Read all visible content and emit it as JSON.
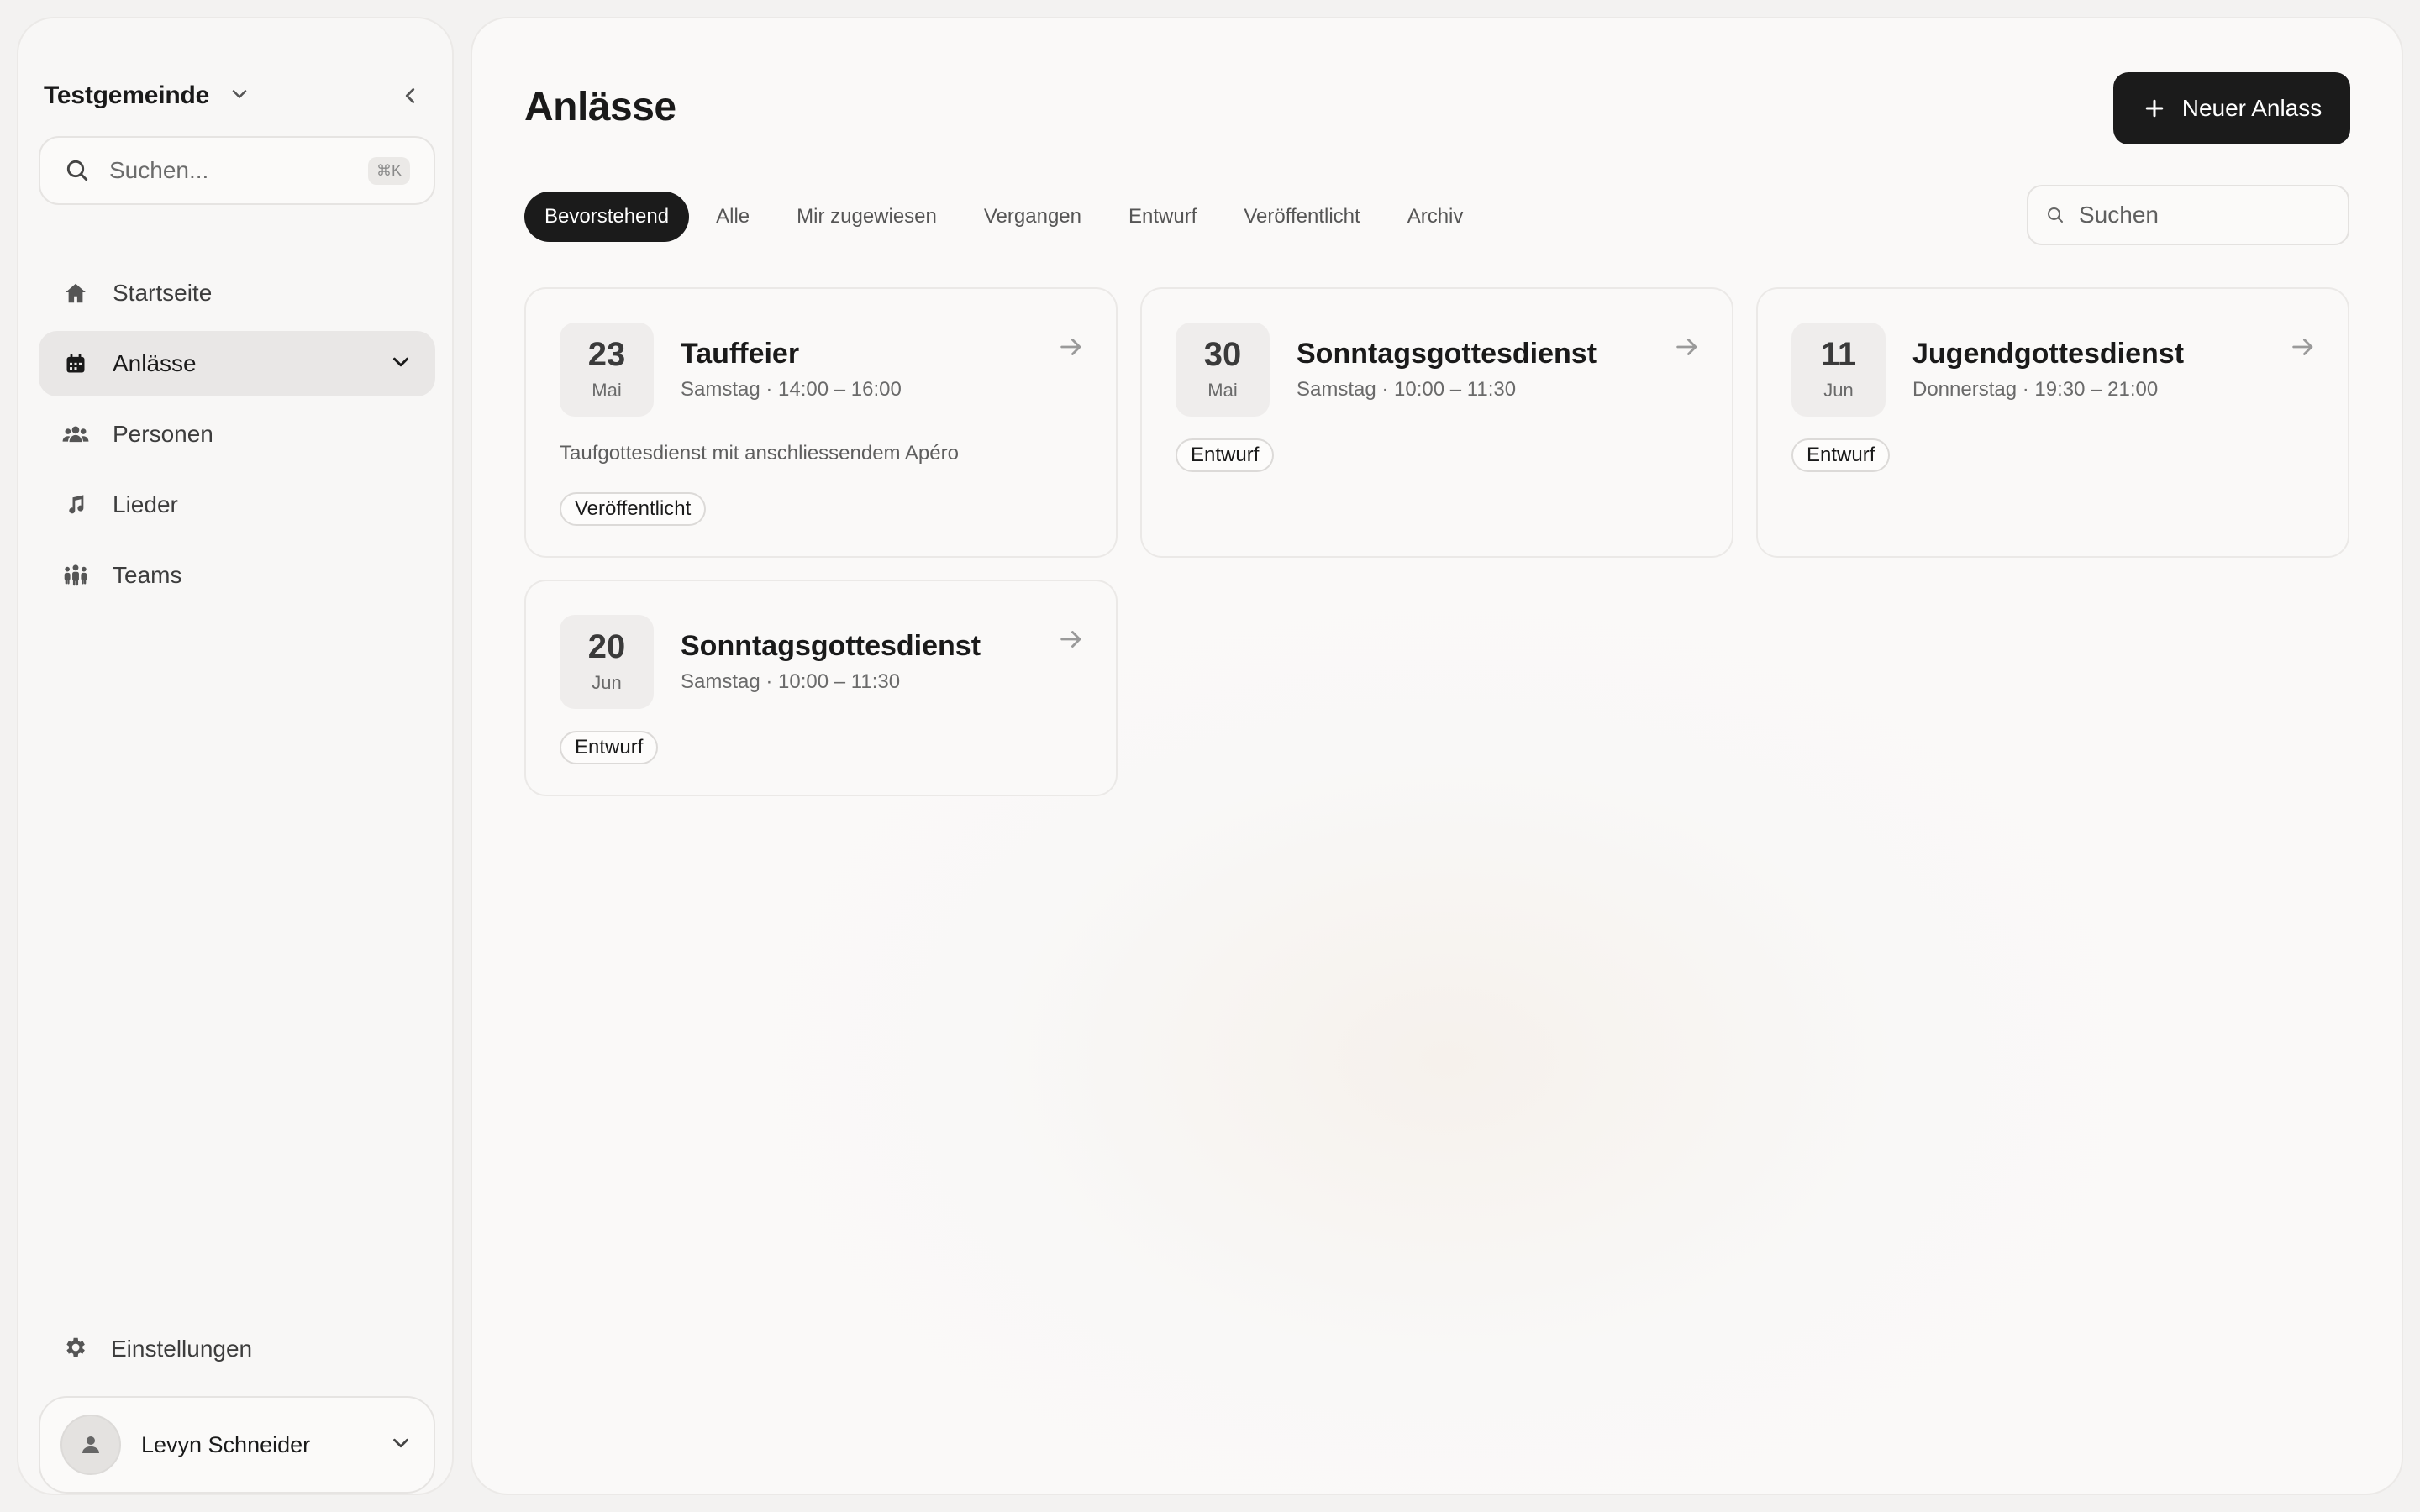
{
  "sidebar": {
    "org_name": "Testgemeinde",
    "search_placeholder": "Suchen...",
    "search_shortcut": "⌘K",
    "nav": [
      {
        "label": "Startseite",
        "icon": "home-icon"
      },
      {
        "label": "Anlässe",
        "icon": "calendar-icon"
      },
      {
        "label": "Personen",
        "icon": "people-icon"
      },
      {
        "label": "Lieder",
        "icon": "music-note-icon"
      },
      {
        "label": "Teams",
        "icon": "team-icon"
      }
    ],
    "active_nav": "Anlässe",
    "settings_label": "Einstellungen",
    "user_name": "Levyn Schneider"
  },
  "main": {
    "title": "Anlässe",
    "new_button_label": "Neuer Anlass",
    "tabs": [
      {
        "label": "Bevorstehend",
        "active": true
      },
      {
        "label": "Alle"
      },
      {
        "label": "Mir zugewiesen"
      },
      {
        "label": "Vergangen"
      },
      {
        "label": "Entwurf"
      },
      {
        "label": "Veröffentlicht"
      },
      {
        "label": "Archiv"
      }
    ],
    "search_placeholder": "Suchen",
    "events": [
      {
        "day": "23",
        "month": "Mai",
        "title": "Tauffeier",
        "time": "Samstag · 14:00 – 16:00",
        "description": "Taufgottesdienst mit anschliessendem Apéro",
        "status": "Veröffentlicht"
      },
      {
        "day": "30",
        "month": "Mai",
        "title": "Sonntagsgottesdienst",
        "time": "Samstag · 10:00 – 11:30",
        "description": "",
        "status": "Entwurf"
      },
      {
        "day": "11",
        "month": "Jun",
        "title": "Jugendgottesdienst",
        "time": "Donnerstag · 19:30 – 21:00",
        "description": "",
        "status": "Entwurf"
      },
      {
        "day": "20",
        "month": "Jun",
        "title": "Sonntagsgottesdienst",
        "time": "Samstag · 10:00 – 11:30",
        "description": "",
        "status": "Entwurf"
      }
    ]
  },
  "colors": {
    "accent": "#1b1b1b",
    "background": "#f3f2f1",
    "panel": "#faf9f8"
  }
}
